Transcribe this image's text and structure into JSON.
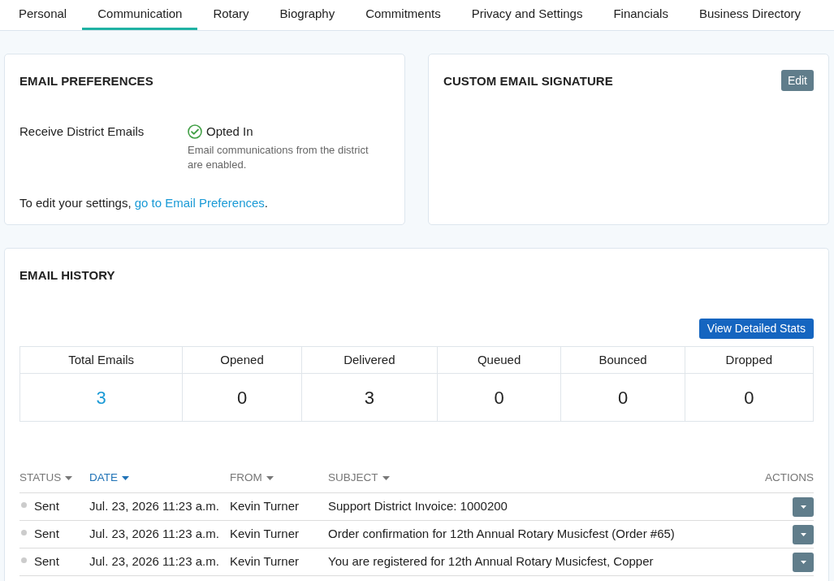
{
  "tabs": [
    {
      "label": "Personal",
      "selected": false
    },
    {
      "label": "Communication",
      "selected": true
    },
    {
      "label": "Rotary",
      "selected": false
    },
    {
      "label": "Biography",
      "selected": false
    },
    {
      "label": "Commitments",
      "selected": false
    },
    {
      "label": "Privacy and Settings",
      "selected": false
    },
    {
      "label": "Financials",
      "selected": false
    },
    {
      "label": "Business Directory",
      "selected": false
    }
  ],
  "email_preferences": {
    "title": "EMAIL PREFERENCES",
    "setting_label": "Receive District Emails",
    "opted_in": true,
    "status": "Opted In",
    "status_note": "Email communications from the district are enabled.",
    "hint_text": "To edit your settings, ",
    "hint_link": "go to Email Preferences",
    "hint_end": "."
  },
  "signature": {
    "title": "CUSTOM EMAIL SIGNATURE",
    "edit_button": "Edit"
  },
  "email_history": {
    "title": "EMAIL HISTORY",
    "stats_button": "View Detailed Stats",
    "stats": [
      {
        "label": "Total Emails",
        "value": "3",
        "kind": "link"
      },
      {
        "label": "Opened",
        "value": "0",
        "kind": "count"
      },
      {
        "label": "Delivered",
        "value": "3",
        "kind": "count"
      },
      {
        "label": "Queued",
        "value": "0",
        "kind": "count"
      },
      {
        "label": "Bounced",
        "value": "0",
        "kind": "count"
      },
      {
        "label": "Dropped",
        "value": "0",
        "kind": "count"
      }
    ],
    "columns": [
      {
        "label": "STATUS",
        "sortable": true,
        "selected": false
      },
      {
        "label": "DATE",
        "sortable": true,
        "selected": true
      },
      {
        "label": "FROM",
        "sortable": true,
        "selected": false
      },
      {
        "label": "SUBJECT",
        "sortable": true,
        "selected": false
      },
      {
        "label": "ACTIONS",
        "sortable": false,
        "selected": false
      }
    ],
    "rows": [
      {
        "status": "Sent",
        "color": "#cccccc",
        "date": "Jul. 23, 2026 11:23 a.m.",
        "from": "Kevin Turner",
        "subject": "Support District Invoice: 1000200"
      },
      {
        "status": "Sent",
        "color": "#cccccc",
        "date": "Jul. 23, 2026 11:23 a.m.",
        "from": "Kevin Turner",
        "subject": "Order confirmation for 12th Annual Rotary Musicfest (Order #65)"
      },
      {
        "status": "Sent",
        "color": "#cccccc",
        "date": "Jul. 23, 2026 11:23 a.m.",
        "from": "Kevin Turner",
        "subject": "You are registered for 12th Annual Rotary Musicfest, Copper"
      }
    ]
  }
}
